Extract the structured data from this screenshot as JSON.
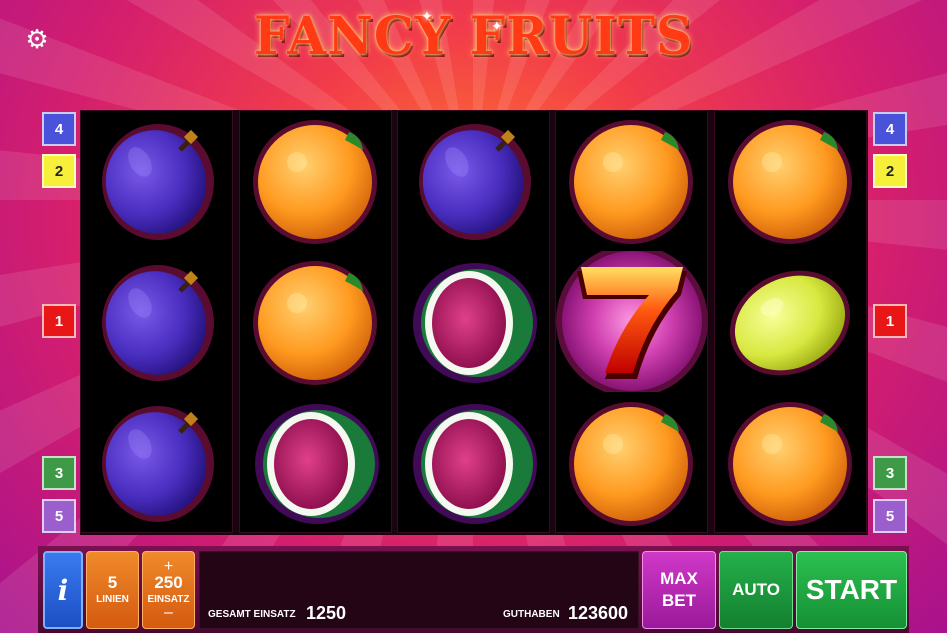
{
  "game": {
    "title": "FANCY FRUITS"
  },
  "icons": {
    "settings": "gear-icon",
    "info": "info-icon"
  },
  "line_markers": {
    "left": [
      "4",
      "2",
      "1",
      "3",
      "5"
    ],
    "right": [
      "4",
      "2",
      "1",
      "3",
      "5"
    ]
  },
  "reels": [
    [
      "plum",
      "plum",
      "plum"
    ],
    [
      "orange",
      "orange",
      "watermelon"
    ],
    [
      "plum",
      "watermelon",
      "watermelon"
    ],
    [
      "orange",
      "seven",
      "orange"
    ],
    [
      "orange",
      "lemon",
      "orange"
    ]
  ],
  "controls": {
    "info_label": "i",
    "lines_value": "5",
    "lines_label": "LINIEN",
    "bet_plus": "+",
    "bet_value": "250",
    "bet_label": "EINSATZ",
    "bet_minus": "–",
    "total_bet_label": "GESAMT EINSATZ",
    "total_bet_value": "1250",
    "balance_label": "GUTHABEN",
    "balance_value": "123600",
    "max_bet_line1": "MAX",
    "max_bet_line2": "BET",
    "auto_label": "AUTO",
    "start_label": "START"
  },
  "colors": {
    "marker_blue": "#4a52d9",
    "marker_yellow": "#f6f03a",
    "marker_red": "#e81616",
    "marker_green": "#3f9a48",
    "marker_purple": "#9a5fcc",
    "start_green": "#2cc050",
    "max_bet_magenta": "#d038c8"
  }
}
